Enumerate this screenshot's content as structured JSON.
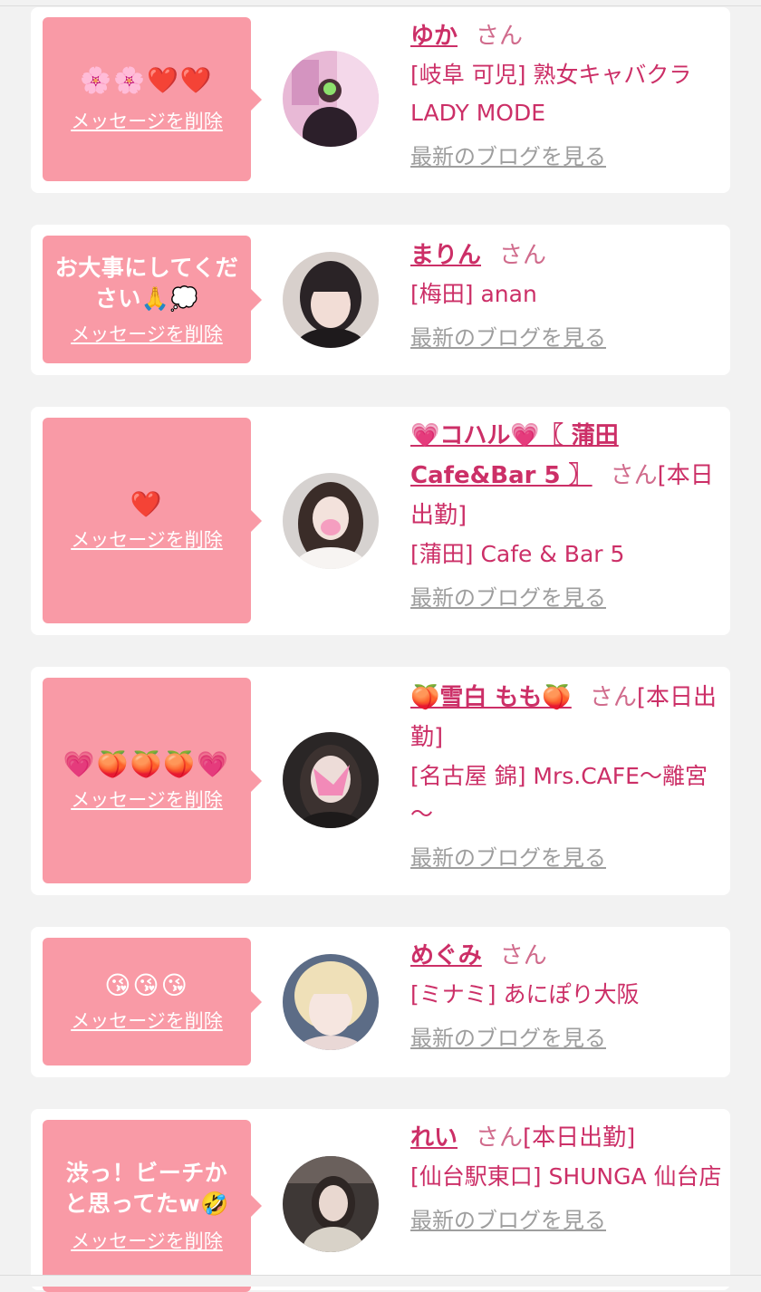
{
  "colors": {
    "bubble": "#f99aa6",
    "accent": "#cc2f67",
    "link_gray": "#9e9e9e",
    "background": "#f2f2f2"
  },
  "delete_label": "メッセージを削除",
  "blog_label": "最新のブログを見る",
  "san_label": "さん",
  "today_label": "[本日出勤]",
  "cards": [
    {
      "message": "🌸🌸❤️❤️",
      "name": "ゆか",
      "today": "",
      "shop": "[岐阜 可児] 熟女キャバクラ LADY MODE"
    },
    {
      "message": "お大事にしてください🙏💭",
      "name": "まりん",
      "today": "",
      "shop": "[梅田] anan"
    },
    {
      "message": "❤️",
      "name": "💗コハル💗〖 蒲田Cafe&Bar 5 〗",
      "today": "[本日出勤]",
      "shop": "[蒲田] Cafe & Bar 5"
    },
    {
      "message": "💗🍑🍑🍑💗",
      "name": "🍑雪白 もも🍑",
      "today": "[本日出勤]",
      "shop": "[名古屋 錦] Mrs.CAFE～離宮～"
    },
    {
      "message": "😘😘😘",
      "name": "めぐみ",
      "today": "",
      "shop": "[ミナミ] あにぽり大阪"
    },
    {
      "message": "渋っ！ビーチかと思ってたw🤣",
      "name": "れい",
      "today": "[本日出勤]",
      "shop": "[仙台駅東口] SHUNGA 仙台店"
    }
  ]
}
